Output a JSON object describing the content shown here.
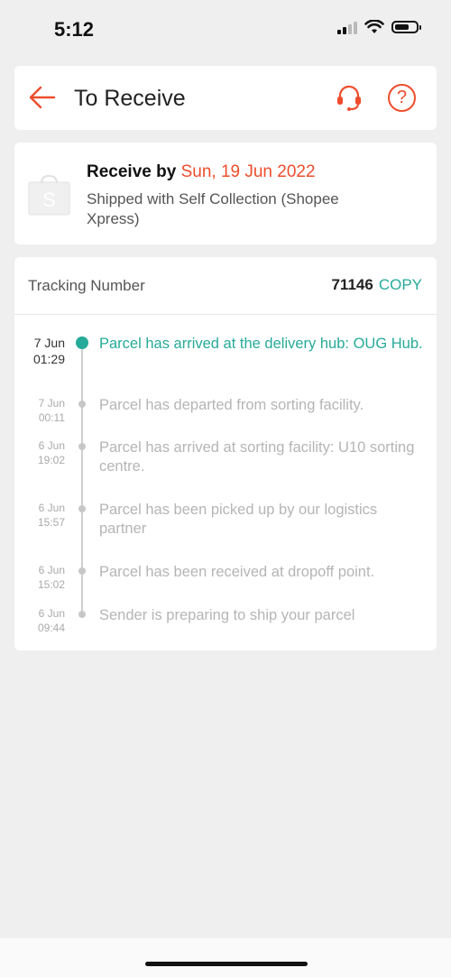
{
  "status_bar": {
    "time": "5:12"
  },
  "header": {
    "title": "To Receive",
    "back_icon": "arrow-left-icon",
    "support_icon": "headset-icon",
    "help_icon": "question-circle-icon",
    "help_symbol": "?"
  },
  "delivery": {
    "receive_prefix": "Receive by",
    "receive_date": "Sun, 19 Jun 2022",
    "shipping_method": "Shipped with Self Collection (Shopee Xpress)",
    "shop_icon_letter": "S"
  },
  "tracking": {
    "label": "Tracking Number",
    "number": "71146",
    "copy_label": "COPY",
    "events": [
      {
        "day": "7 Jun",
        "time": "01:29",
        "text": "Parcel has arrived at the delivery hub: OUG Hub."
      },
      {
        "day": "7 Jun",
        "time": "00:11",
        "text": "Parcel has departed from sorting facility."
      },
      {
        "day": "6 Jun",
        "time": "19:02",
        "text": "Parcel has arrived at sorting facility: U10 sorting centre."
      },
      {
        "day": "6 Jun",
        "time": "15:57",
        "text": "Parcel has been picked up by our logistics partner"
      },
      {
        "day": "6 Jun",
        "time": "15:02",
        "text": "Parcel has been received at dropoff point."
      },
      {
        "day": "6 Jun",
        "time": "09:44",
        "text": "Sender is preparing to ship your parcel"
      }
    ]
  },
  "colors": {
    "accent": "#ee4d2d",
    "teal": "#26aa99",
    "background": "#efefef"
  }
}
